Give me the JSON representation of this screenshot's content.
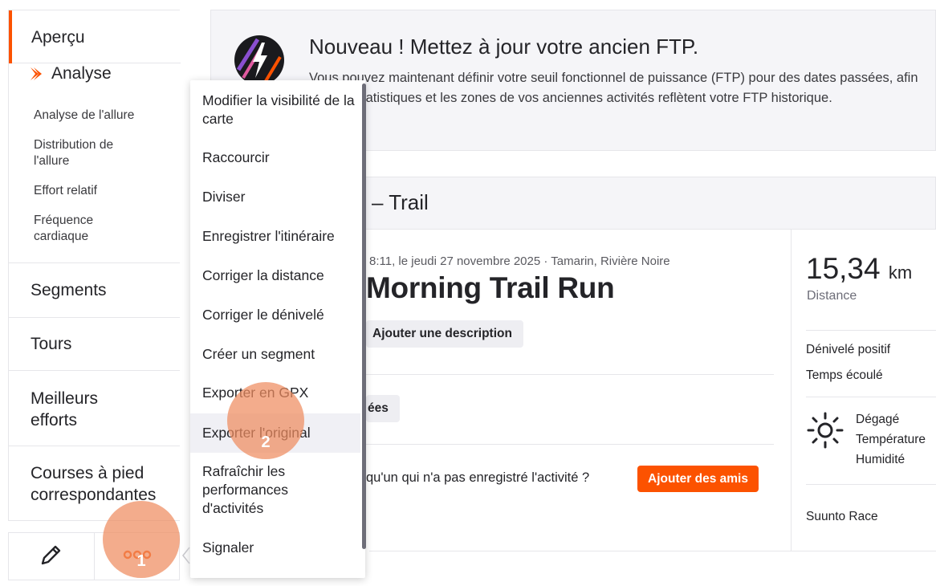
{
  "sidebar": {
    "overview": "Aperçu",
    "analyse": "Analyse",
    "sub_items": [
      "Analyse de l'allure",
      "Distribution de l'allure",
      "Effort relatif",
      "Fréquence cardiaque"
    ],
    "sections": [
      "Segments",
      "Tours",
      "Meilleurs efforts",
      "Courses à pied correspondantes"
    ],
    "tools": {
      "edit_icon": "pencil-icon",
      "more_icon": "more-options-icon"
    }
  },
  "banner": {
    "title": "Nouveau ! Mettez à jour votre ancien FTP.",
    "description": "Vous pouvez maintenant définir votre seuil fonctionnel de puissance (FTP) pour des dates passées, afin que les statistiques et les zones de vos anciennes activités reflètent votre FTP historique.",
    "icon": "lightning-icon"
  },
  "activity": {
    "header_title": "– Trail",
    "meta": "8:11, le jeudi 27 novembre 2025 · Tamarin, Rivière Noire",
    "title": "Morning Trail Run",
    "add_description": "Ajouter une description",
    "partial_button": "ées",
    "friends_question": "qu'un qui n'a pas enregistré l'activité ?",
    "add_friends": "Ajouter des amis"
  },
  "stats": {
    "distance_value": "15,34",
    "distance_unit": "km",
    "distance_label": "Distance",
    "elevation_label": "Dénivelé positif",
    "elapsed_label": "Temps écoulé",
    "weather_icon": "sun-icon",
    "weather_condition": "Dégagé",
    "temperature_label": "Température",
    "humidity_label": "Humidité",
    "device": "Suunto Race"
  },
  "menu": {
    "items": [
      "Modifier la visibilité de la carte",
      "Raccourcir",
      "Diviser",
      "Enregistrer l'itinéraire",
      "Corriger la distance",
      "Corriger le dénivelé",
      "Créer un segment",
      "Exporter en GPX",
      "Exporter l'original",
      "Rafraîchir les performances d'activités",
      "Signaler"
    ]
  },
  "markers": {
    "first": "1",
    "second": "2"
  },
  "colors": {
    "accent": "#fc5200",
    "marker": "#ef8c60"
  }
}
